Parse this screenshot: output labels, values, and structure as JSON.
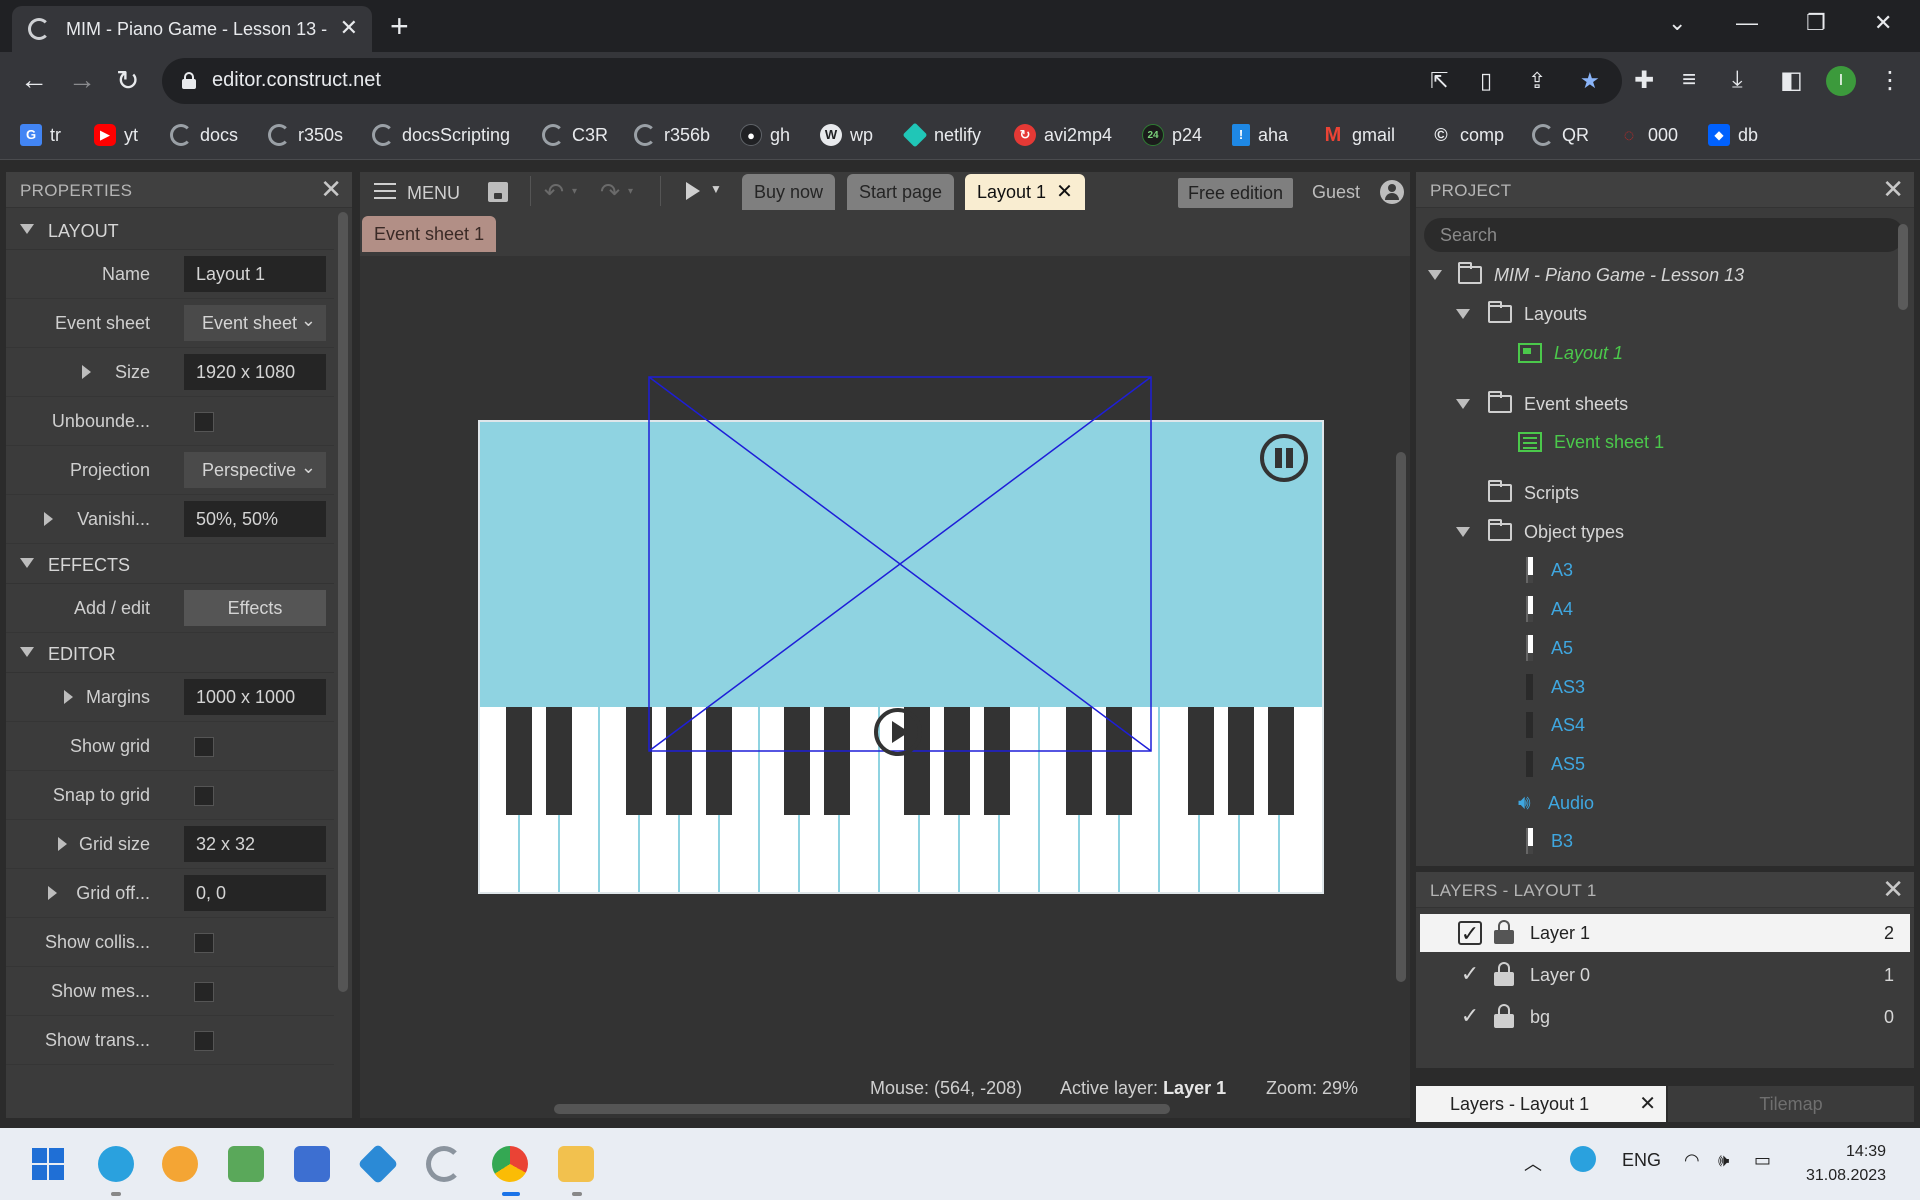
{
  "browser": {
    "tab_title": "MIM - Piano Game - Lesson 13 -",
    "url": "editor.construct.net",
    "profile_initial": "I",
    "bookmarks": [
      {
        "label": "tr",
        "icon": "google-translate-icon",
        "color": "#4285f4"
      },
      {
        "label": "yt",
        "icon": "youtube-icon",
        "color": "#ff0000"
      },
      {
        "label": "docs",
        "icon": "construct-icon",
        "color": "#9aa0a6"
      },
      {
        "label": "r350s",
        "icon": "construct-icon",
        "color": "#9aa0a6"
      },
      {
        "label": "docsScripting",
        "icon": "construct-icon",
        "color": "#9aa0a6"
      },
      {
        "label": "C3R",
        "icon": "construct-icon",
        "color": "#9aa0a6"
      },
      {
        "label": "r356b",
        "icon": "construct-icon",
        "color": "#9aa0a6"
      },
      {
        "label": "gh",
        "icon": "github-icon",
        "color": "#202124"
      },
      {
        "label": "wp",
        "icon": "wordpress-icon",
        "color": "#e8eaed"
      },
      {
        "label": "netlify",
        "icon": "netlify-icon",
        "color": "#20c6b7"
      },
      {
        "label": "avi2mp4",
        "icon": "convert-icon",
        "color": "#e53935"
      },
      {
        "label": "p24",
        "icon": "p24-icon",
        "color": "#2e7d32"
      },
      {
        "label": "aha",
        "icon": "exclamation-icon",
        "color": "#1e88e5"
      },
      {
        "label": "gmail",
        "icon": "gmail-icon",
        "color": "#ea4335"
      },
      {
        "label": "comp",
        "icon": "comp-icon",
        "color": "#e8eaed"
      },
      {
        "label": "QR",
        "icon": "construct-icon",
        "color": "#9aa0a6"
      },
      {
        "label": "000",
        "icon": "000-icon",
        "color": "#c62828"
      },
      {
        "label": "db",
        "icon": "dropbox-icon",
        "color": "#0061fe"
      }
    ]
  },
  "properties": {
    "title": "PROPERTIES",
    "sections": {
      "layout": "LAYOUT",
      "effects": "EFFECTS",
      "editor": "EDITOR"
    },
    "rows": {
      "name_label": "Name",
      "name_value": "Layout 1",
      "eventsheet_label": "Event sheet",
      "eventsheet_value": "Event sheet",
      "size_label": "Size",
      "size_value": "1920 x 1080",
      "unbounded_label": "Unbounde...",
      "projection_label": "Projection",
      "projection_value": "Perspective",
      "vanishing_label": "Vanishi...",
      "vanishing_value": "50%, 50%",
      "addedit_label": "Add / edit",
      "effects_button": "Effects",
      "margins_label": "Margins",
      "margins_value": "1000 x 1000",
      "showgrid_label": "Show grid",
      "snap_label": "Snap to grid",
      "gridsize_label": "Grid size",
      "gridsize_value": "32 x 32",
      "gridoff_label": "Grid off...",
      "gridoff_value": "0, 0",
      "showcollis_label": "Show collis...",
      "showmes_label": "Show mes...",
      "showtrans_label": "Show trans..."
    }
  },
  "editor": {
    "menu_label": "MENU",
    "tabs": {
      "buy": "Buy now",
      "start": "Start page",
      "layout": "Layout 1"
    },
    "free_edition": "Free edition",
    "guest": "Guest",
    "event_tab": "Event sheet 1",
    "status": {
      "mouse_label": "Mouse:",
      "mouse_value": "(564, -208)",
      "active_label": "Active layer:",
      "active_value": "Layer 1",
      "zoom_label": "Zoom:",
      "zoom_value": "29%"
    }
  },
  "project": {
    "title": "PROJECT",
    "search_placeholder": "Search",
    "root": "MIM - Piano Game - Lesson 13",
    "layouts_folder": "Layouts",
    "layout_item": "Layout 1",
    "eventsheets_folder": "Event sheets",
    "eventsheet_item": "Event sheet 1",
    "scripts_folder": "Scripts",
    "objecttypes_folder": "Object types",
    "objects": [
      "A3",
      "A4",
      "A5",
      "AS3",
      "AS4",
      "AS5",
      "Audio",
      "B3"
    ]
  },
  "layers": {
    "title": "LAYERS - LAYOUT 1",
    "items": [
      {
        "name": "Layer 1",
        "count": "2"
      },
      {
        "name": "Layer 0",
        "count": "1"
      },
      {
        "name": "bg",
        "count": "0"
      }
    ],
    "tab_active": "Layers - Layout 1",
    "tab_other": "Tilemap"
  },
  "taskbar": {
    "lang": "ENG",
    "time": "14:39",
    "date": "31.08.2023"
  },
  "colors": {
    "scene_bg": "#8fd3e1",
    "active_tab": "#f9edd1",
    "tree_green": "#4bc94b",
    "tree_blue": "#3fa7e0",
    "bounds_blue": "#1e1ed8"
  }
}
